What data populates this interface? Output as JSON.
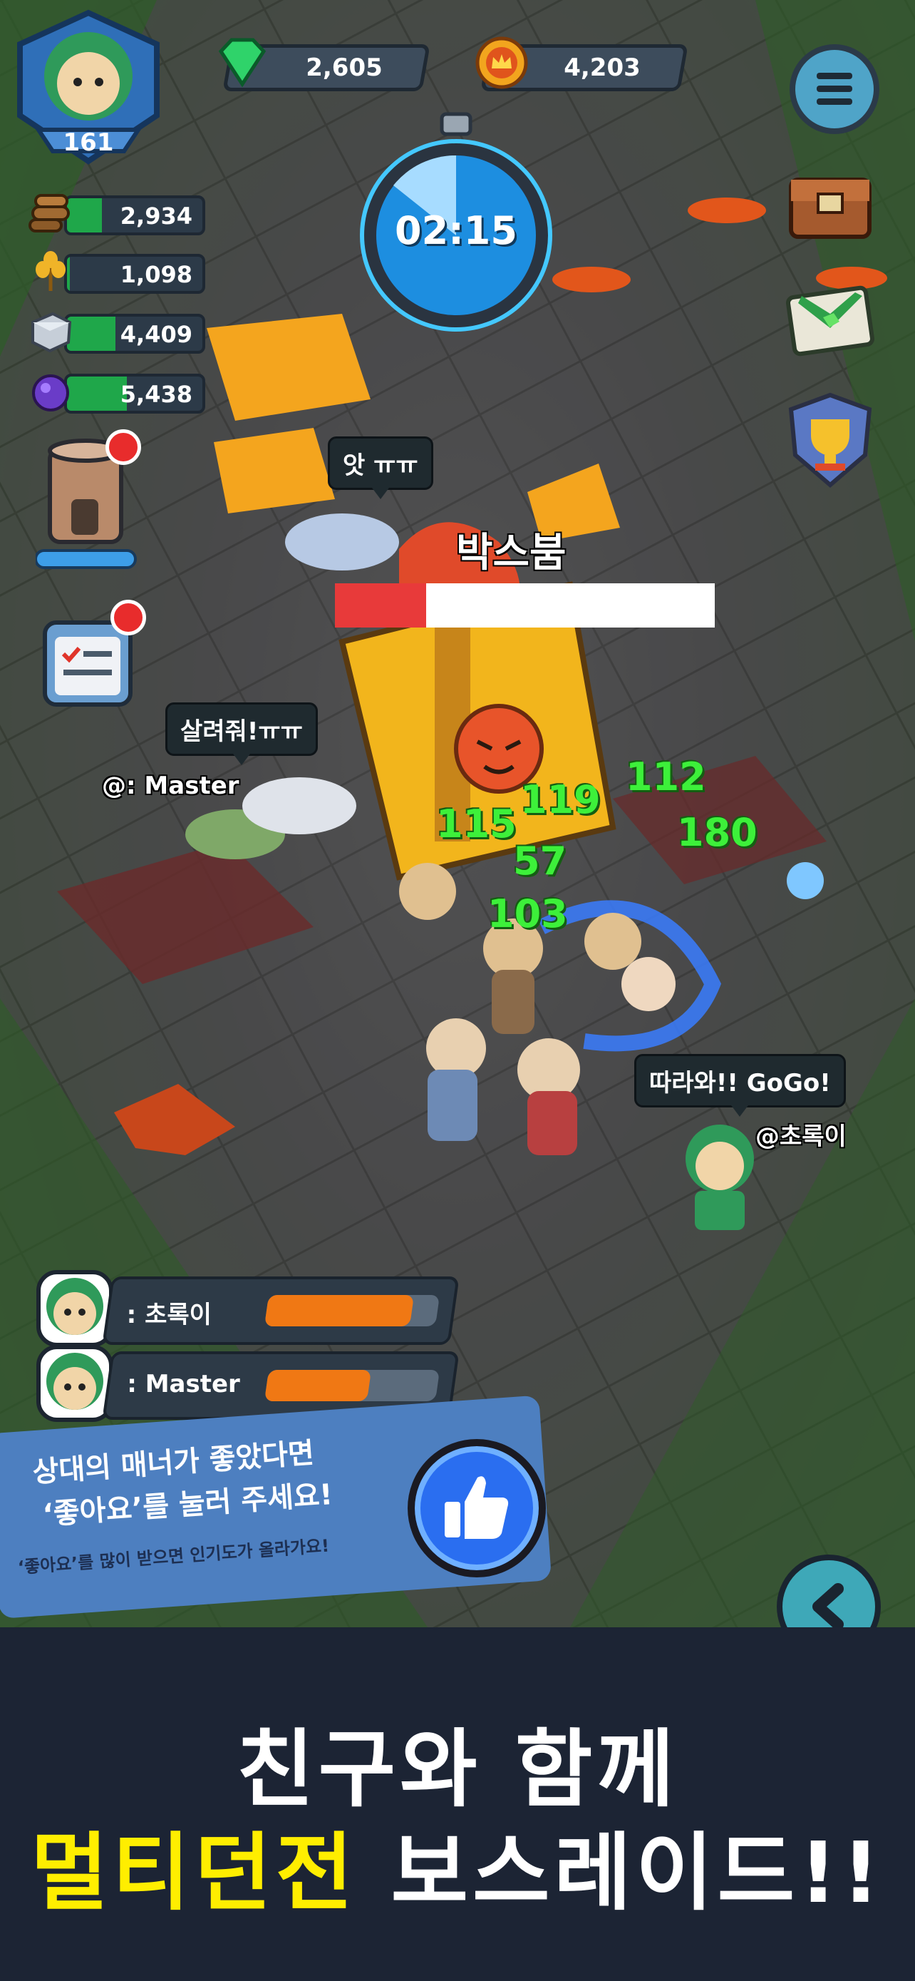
{
  "hud": {
    "level": "161",
    "gems": "2,605",
    "coins": "4,203",
    "timer": "02:15",
    "resources": [
      {
        "name": "wood",
        "icon": "wood-log-icon",
        "value": "2,934"
      },
      {
        "name": "wheat",
        "icon": "wheat-icon",
        "value": "1,098"
      },
      {
        "name": "stone",
        "icon": "stone-block-icon",
        "value": "4,409"
      },
      {
        "name": "ore",
        "icon": "purple-ore-icon",
        "value": "5,438"
      }
    ]
  },
  "boss": {
    "name": "박스붐",
    "hp_fraction": 0.24
  },
  "bubbles": {
    "ally_cry": "앗 ㅠㅠ",
    "help": "살려줘!ㅠㅠ",
    "follow": "따라와!! GoGo!"
  },
  "tags": {
    "master": "@: Master",
    "chorok": "@초록이"
  },
  "damage_numbers": [
    "112",
    "119",
    "115",
    "180",
    "57",
    "103"
  ],
  "players": [
    {
      "label": ": 초록이",
      "progress": 0.85
    },
    {
      "label": ": Master",
      "progress": 0.6
    }
  ],
  "like_panel": {
    "line1": "상대의 매너가 좋았다면",
    "line2": "‘좋아요’를 눌러 주세요!",
    "sub": "‘좋아요’를 많이 받으면 인기도가 올라가요!"
  },
  "promo": {
    "line1": "친구와 함께",
    "highlight": "멀티던전",
    "line2_rest": " 보스레이드!!"
  },
  "colors": {
    "highlight": "#ffee00",
    "damage": "#3df03a",
    "boss_hp": "#e83a3a",
    "bottom_bg": "#1c2434"
  }
}
